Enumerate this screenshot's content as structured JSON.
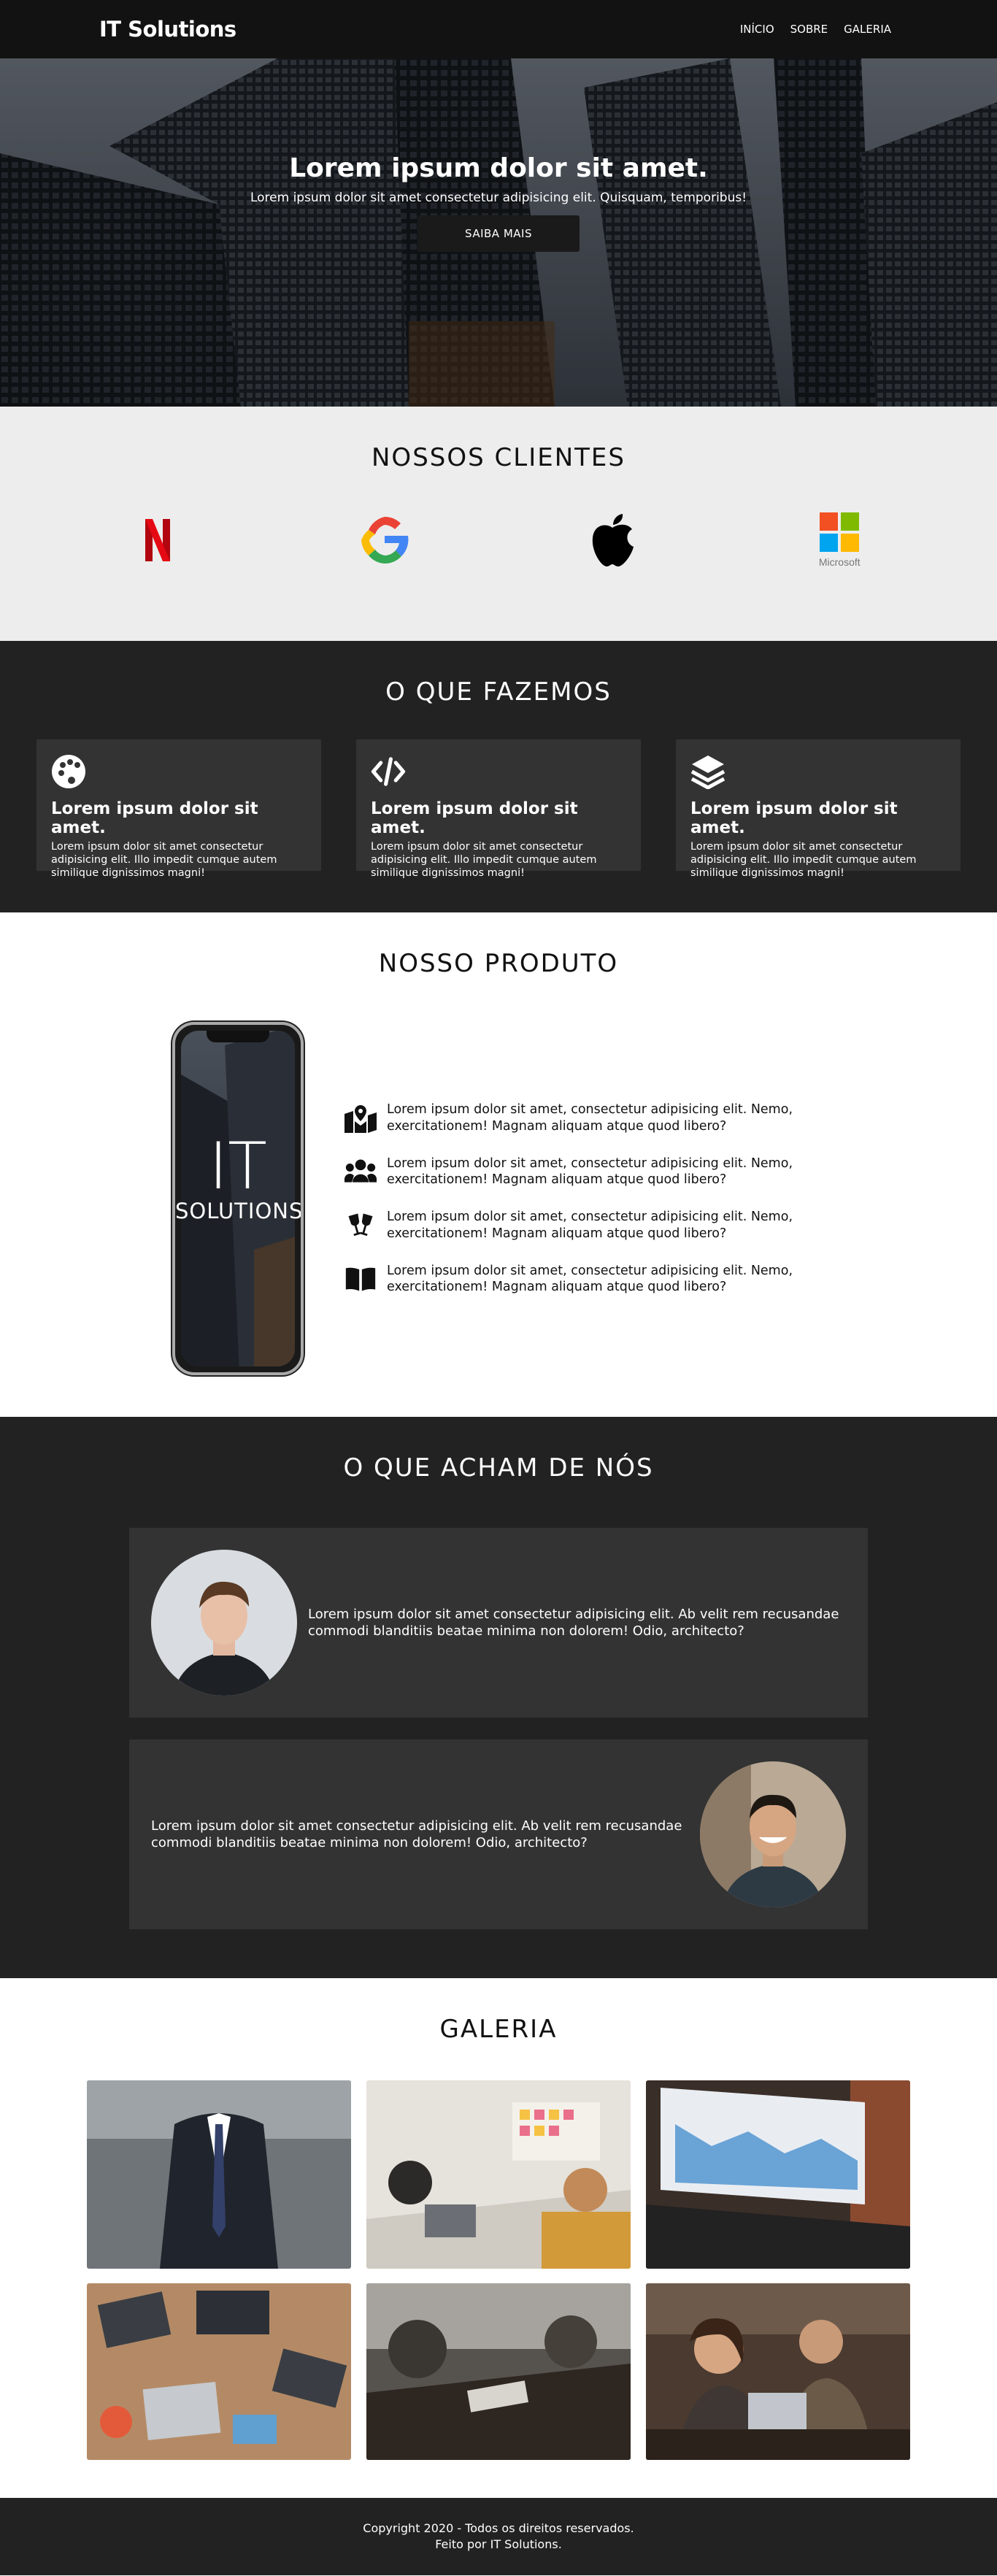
{
  "nav": {
    "brand": "IT Solutions",
    "links": [
      "INÍCIO",
      "SOBRE",
      "GALERIA"
    ]
  },
  "hero": {
    "title": "Lorem ipsum dolor sit amet.",
    "subtitle": "Lorem ipsum dolor sit amet consectetur adipisicing elit. Quisquam, temporibus!",
    "button": "SAIBA MAIS"
  },
  "clients": {
    "title": "NOSSOS CLIENTES",
    "logos": [
      "netflix-logo",
      "google-logo",
      "apple-logo",
      "microsoft-logo"
    ],
    "microsoft_label": "Microsoft"
  },
  "services": {
    "title": "O QUE FAZEMOS",
    "cards": [
      {
        "icon": "palette-icon",
        "title": "Lorem ipsum dolor sit amet.",
        "text": "Lorem ipsum dolor sit amet consectetur adipisicing elit. Illo impedit cumque autem similique dignissimos magni!"
      },
      {
        "icon": "code-icon",
        "title": "Lorem ipsum dolor sit amet.",
        "text": "Lorem ipsum dolor sit amet consectetur adipisicing elit. Illo impedit cumque autem similique dignissimos magni!"
      },
      {
        "icon": "layers-icon",
        "title": "Lorem ipsum dolor sit amet.",
        "text": "Lorem ipsum dolor sit amet consectetur adipisicing elit. Illo impedit cumque autem similique dignissimos magni!"
      }
    ]
  },
  "product": {
    "title": "NOSSO PRODUTO",
    "phone_logo_big": "IT",
    "phone_logo_small": "SOLUTIONS",
    "features": [
      {
        "icon": "map-marked-icon",
        "text": "Lorem ipsum dolor sit amet, consectetur adipisicing elit. Nemo, exercitationem! Magnam aliquam atque quod libero?"
      },
      {
        "icon": "users-icon",
        "text": "Lorem ipsum dolor sit amet, consectetur adipisicing elit. Nemo, exercitationem! Magnam aliquam atque quod libero?"
      },
      {
        "icon": "glass-cheers-icon",
        "text": "Lorem ipsum dolor sit amet, consectetur adipisicing elit. Nemo, exercitationem! Magnam aliquam atque quod libero?"
      },
      {
        "icon": "book-open-icon",
        "text": "Lorem ipsum dolor sit amet, consectetur adipisicing elit. Nemo, exercitationem! Magnam aliquam atque quod libero?"
      }
    ]
  },
  "testimonials": {
    "title": "O QUE ACHAM DE NÓS",
    "items": [
      {
        "text": "Lorem ipsum dolor sit amet consectetur adipisicing elit. Ab velit rem recusandae commodi blanditiis beatae minima non dolorem! Odio, architecto?"
      },
      {
        "text": "Lorem ipsum dolor sit amet consectetur adipisicing elit. Ab velit rem recusandae commodi blanditiis beatae minima non dolorem! Odio, architecto?"
      }
    ]
  },
  "gallery": {
    "title": "GALERIA",
    "images": [
      "businessman-photo",
      "meeting-photo",
      "laptop-dashboard-photo",
      "desk-overhead-photo",
      "teamwork-table-photo",
      "coworkers-laptop-photo"
    ]
  },
  "footer": {
    "line1": "Copyright 2020 - Todos os direitos reservados.",
    "line2": "Feito por IT Solutions."
  },
  "colors": {
    "nav_bg": "#121212",
    "dark_section": "#222222",
    "card_bg": "#333333",
    "light_section": "#ededed",
    "netflix_red": "#e50914"
  }
}
